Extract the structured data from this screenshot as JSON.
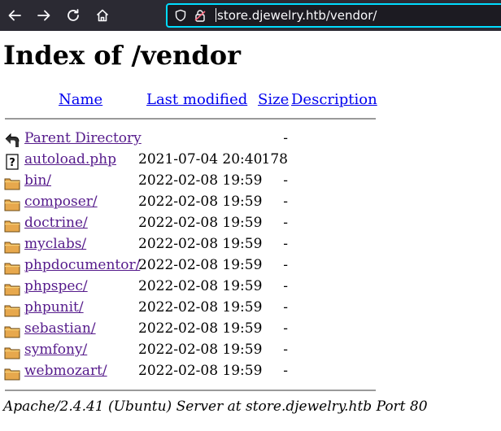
{
  "browser": {
    "url": "store.djewelry.htb/vendor/"
  },
  "page": {
    "title": "Index of /vendor",
    "columns": {
      "name": "Name",
      "last_modified": "Last modified",
      "size": "Size",
      "description": "Description"
    },
    "rows": [
      {
        "icon": "back-icon",
        "name": "Parent Directory",
        "modified": "",
        "size": "-"
      },
      {
        "icon": "file-unknown-icon",
        "name": "autoload.php",
        "modified": "2021-07-04 20:40",
        "size": "178"
      },
      {
        "icon": "folder-icon",
        "name": "bin/",
        "modified": "2022-02-08 19:59",
        "size": "-"
      },
      {
        "icon": "folder-icon",
        "name": "composer/",
        "modified": "2022-02-08 19:59",
        "size": "-"
      },
      {
        "icon": "folder-icon",
        "name": "doctrine/",
        "modified": "2022-02-08 19:59",
        "size": "-"
      },
      {
        "icon": "folder-icon",
        "name": "myclabs/",
        "modified": "2022-02-08 19:59",
        "size": "-"
      },
      {
        "icon": "folder-icon",
        "name": "phpdocumentor/",
        "modified": "2022-02-08 19:59",
        "size": "-"
      },
      {
        "icon": "folder-icon",
        "name": "phpspec/",
        "modified": "2022-02-08 19:59",
        "size": "-"
      },
      {
        "icon": "folder-icon",
        "name": "phpunit/",
        "modified": "2022-02-08 19:59",
        "size": "-"
      },
      {
        "icon": "folder-icon",
        "name": "sebastian/",
        "modified": "2022-02-08 19:59",
        "size": "-"
      },
      {
        "icon": "folder-icon",
        "name": "symfony/",
        "modified": "2022-02-08 19:59",
        "size": "-"
      },
      {
        "icon": "folder-icon",
        "name": "webmozart/",
        "modified": "2022-02-08 19:59",
        "size": "-"
      }
    ],
    "footer": "Apache/2.4.41 (Ubuntu) Server at store.djewelry.htb Port 80"
  },
  "colors": {
    "toolbar_bg": "#2b2a33",
    "urlbar_focus": "#00ddff",
    "link": "#0000ee",
    "visited_link": "#551a8b"
  }
}
